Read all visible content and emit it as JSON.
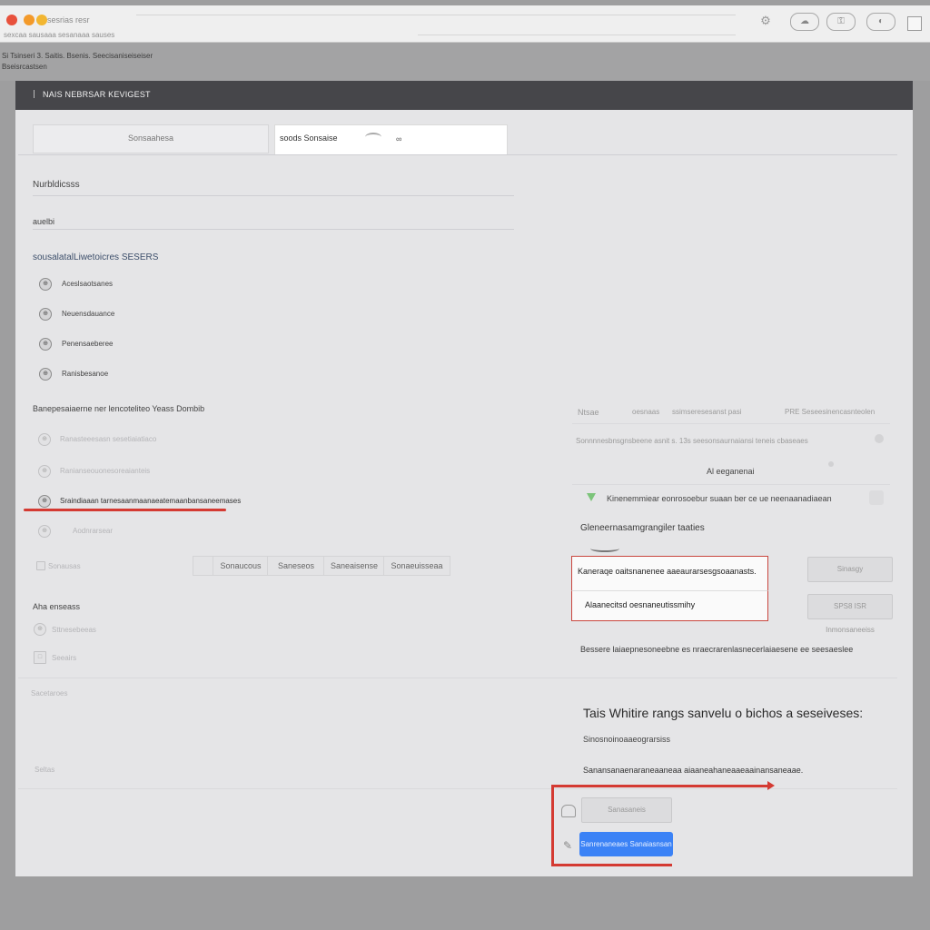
{
  "browser": {
    "tab_title": "sesrias resr",
    "url": "sexcaa sausaaa sesanaaa sauses",
    "icons": [
      "settings-icon",
      "cloud-icon",
      "key-icon",
      "ear-icon",
      "grid-icon"
    ]
  },
  "header_bar": {
    "line1": "Si Tsinseri 3. Saitis. Bsenis. Seecisaniseiseiser",
    "line2": "Bseisrcastsen"
  },
  "panel": {
    "title": "NAIS NEBRSAR KEVIGEST",
    "search_left_placeholder": "Sonsaahesa",
    "search_right_value": "soods Sonsaise",
    "section1_label": "Nurbldicsss",
    "section2_label": "auelbi",
    "list_heading": "sousalatalLiwetoicres SESERS",
    "list_items": [
      "Aceslsaotsanes",
      "Neuensdauance",
      "Penensaeberee",
      "Ranisbesanoe"
    ],
    "group_heading": "Banepesaiaerne ner lencoteliteo Yeass Dombib",
    "group_items": [
      "Ranasteeesasn sesetiaiatiaco",
      "Ranianseouonesoreaianteis"
    ],
    "highlighted_item": "Sraindiaaan tarnesaanmaanaeatemaanbansaneemases",
    "group_item_after": "Aodnrarsear",
    "segments": [
      "Sonausas",
      "Sonaucous",
      "Saneseos",
      "Saneaisense",
      "Sonaeuisseaa"
    ],
    "misc_heading": "Aha enseass",
    "misc_items": [
      "Sttnesebeeas",
      "Seeairs"
    ],
    "footer_left1": "Sacetaroes",
    "footer_left2": "Seltas"
  },
  "right": {
    "table_headers": [
      "Ntsae",
      "oesnaas",
      "ssimseresesanst pasi",
      "PRE Seseesinencasnteolen"
    ],
    "row1": "Sonnnnesbnsgnsbeene asnit s. 13s seesonsaurnaiansi teneis cbaseaes",
    "align_label": "Al eeganenai",
    "check_row": "Kinenemmiear eonrosoebur suaan ber ce ue neenaanadiaean",
    "section_title": "Gleneernasamgrangiler taaties",
    "alert1": "Kaneraqe oaitsnanenee aaeaurarsesgsoaanasts.",
    "alert2": "Alaanecitsd oesnaneutissmihy",
    "side_btn1": "Sinasgy",
    "side_btn2": "SPS8 ISR Inmonsaneeiss",
    "note": "Bessere laiaepnesoneebne es nraecrarenlasnecerlaiaesene ee seesaeslee",
    "big_heading": "Tais Whitire rangs sanvelu o bichos a seseiveses:",
    "sub1": "Sinosnoinoaaeograrsiss",
    "sub2": "Sanansanaenaraneaaneaa aiaaneahaneaaeaainansaneaae.",
    "btn_secondary": "Sanasaneis",
    "btn_primary": "Sanrenaneaes Sanaiasnsan"
  },
  "colors": {
    "accent_blue": "#3b82f6",
    "alert_red": "#d43a32",
    "header_dark": "#46464a"
  }
}
